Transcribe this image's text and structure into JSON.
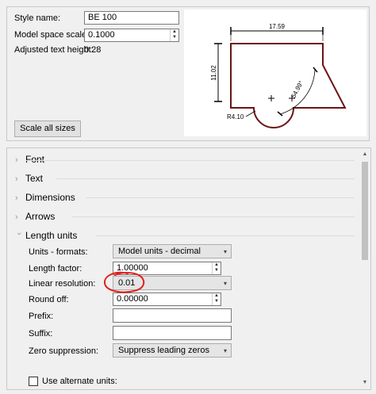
{
  "style": {
    "name_label": "Style name:",
    "name_value": "BE 100",
    "scale_label": "Model space scale:",
    "scale_value": "0.1000",
    "adjusted_label": "Adjusted text height:",
    "adjusted_value": "0.28",
    "scale_all_button": "Scale all sizes"
  },
  "preview": {
    "dim_horizontal": "17.59",
    "dim_vertical": "11.02",
    "dim_angle": "54.99°",
    "dim_radius": "R4.10"
  },
  "sections": [
    {
      "label": "Font",
      "expanded": false
    },
    {
      "label": "Text",
      "expanded": false
    },
    {
      "label": "Dimensions",
      "expanded": false
    },
    {
      "label": "Arrows",
      "expanded": false
    },
    {
      "label": "Length units",
      "expanded": true
    }
  ],
  "length_units": {
    "units_formats_label": "Units - formats:",
    "units_formats_value": "Model units - decimal",
    "length_factor_label": "Length factor:",
    "length_factor_value": "1.00000",
    "linear_resolution_label": "Linear resolution:",
    "linear_resolution_value": "0.01",
    "round_off_label": "Round off:",
    "round_off_value": "0.00000",
    "prefix_label": "Prefix:",
    "prefix_value": "",
    "suffix_label": "Suffix:",
    "suffix_value": "",
    "zero_suppression_label": "Zero suppression:",
    "zero_suppression_value": "Suppress leading zeros",
    "alternate_units_label": "Use alternate units:",
    "alternate_units_checked": false
  },
  "colors": {
    "shape_stroke": "#6b1414",
    "annotation_red": "#e0201c"
  }
}
